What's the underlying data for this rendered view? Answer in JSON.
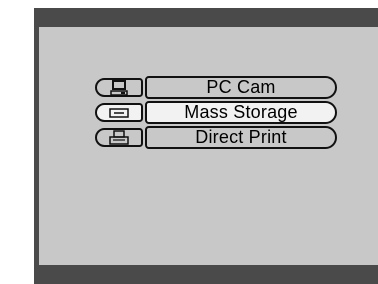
{
  "menu": {
    "items": [
      {
        "label": "PC Cam",
        "icon": "computer-icon",
        "selected": false
      },
      {
        "label": "Mass Storage",
        "icon": "storage-drive-icon",
        "selected": true
      },
      {
        "label": "Direct  Print",
        "icon": "printer-icon",
        "selected": false
      }
    ]
  },
  "colors": {
    "frame": "#4a4a4a",
    "screen": "#c8c8c8",
    "selected_bg": "#f2f2f2",
    "outline": "#111111"
  }
}
